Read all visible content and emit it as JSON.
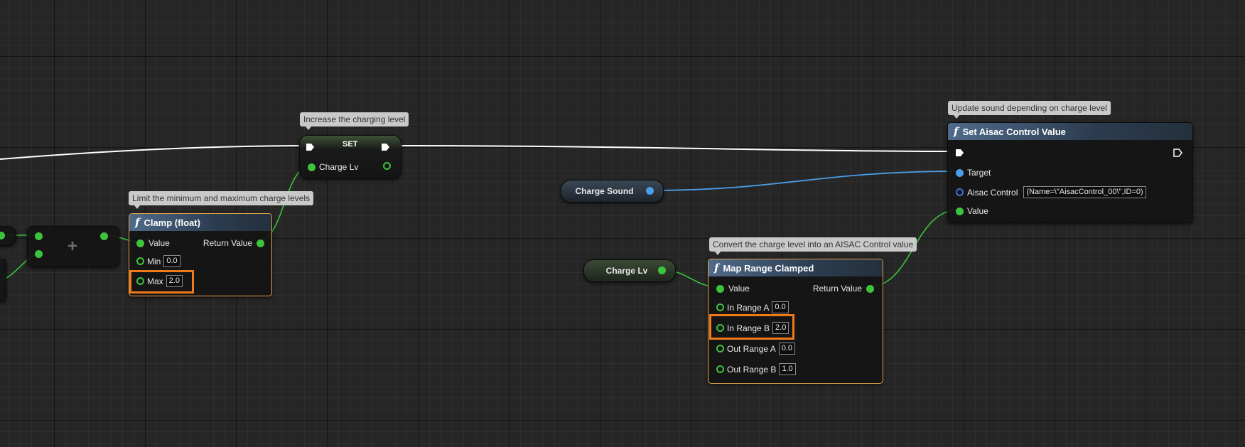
{
  "comments": {
    "set": "Increase the charging level",
    "clamp": "Limit the minimum and maximum charge levels",
    "aisac": "Update sound depending on charge level",
    "map_range": "Convert the charge level into an AISAC Control value"
  },
  "set_node": {
    "title": "SET",
    "pin_label": "Charge Lv"
  },
  "add_node": {
    "symbol": "+"
  },
  "clamp_node": {
    "title": "Clamp (float)",
    "value_label": "Value",
    "return_label": "Return Value",
    "min_label": "Min",
    "min_value": "0.0",
    "max_label": "Max",
    "max_value": "2.0"
  },
  "charge_sound_var": {
    "label": "Charge Sound"
  },
  "charge_lv_var": {
    "label": "Charge Lv"
  },
  "aisac_node": {
    "title": "Set Aisac Control Value",
    "target_label": "Target",
    "control_label": "Aisac Control",
    "control_value": "(Name=\\\"AisacControl_00\\\",ID=0)",
    "value_label": "Value"
  },
  "map_range_node": {
    "title": "Map Range Clamped",
    "value_label": "Value",
    "return_label": "Return Value",
    "in_a_label": "In Range A",
    "in_a_value": "0.0",
    "in_b_label": "In Range B",
    "in_b_value": "2.0",
    "out_a_label": "Out Range A",
    "out_a_value": "0.0",
    "out_b_label": "Out Range B",
    "out_b_value": "1.0"
  },
  "icons": {
    "function": "function-icon",
    "exec": "exec-pin-icon"
  },
  "colors": {
    "float_pin": "#3cc43c",
    "object_pin": "#4a9fe8",
    "struct_pin": "#3f6fd8",
    "exec_wire": "#ffffff",
    "selection": "#e8a64a",
    "highlight": "#f07a1a"
  }
}
